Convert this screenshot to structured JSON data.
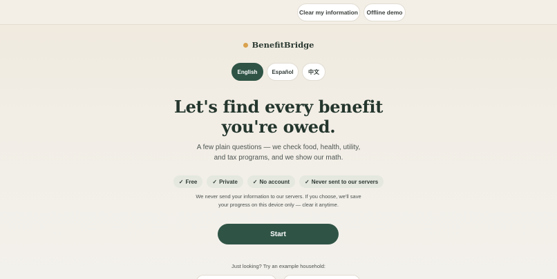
{
  "topbar": {
    "clear_label": "Clear my information",
    "offline_label": "Offline demo"
  },
  "brand": {
    "name": "BenefitBridge",
    "dot_color": "#d9a24e"
  },
  "languages": [
    {
      "label": "English",
      "selected": true
    },
    {
      "label": "Español",
      "selected": false
    },
    {
      "label": "中文",
      "selected": false
    }
  ],
  "hero": {
    "headline_line1": "Let's find every benefit",
    "headline_line2": "you're owed.",
    "sub_line1": "A few plain questions — we check food, health, utility,",
    "sub_line2": "and tax programs, and we show our math."
  },
  "chips": [
    {
      "check": "✓",
      "label": "Free"
    },
    {
      "check": "✓",
      "label": "Private"
    },
    {
      "check": "✓",
      "label": "No account"
    },
    {
      "check": "✓",
      "label": "Never sent to our servers"
    }
  ],
  "privacy": {
    "line1": "We never send your information to our servers. If you choose, we'll save",
    "line2": "your progress on this device only — clear it anytime."
  },
  "start_label": "Start",
  "example": {
    "label": "Just looking? Try an example household:"
  },
  "colors": {
    "primary": "#2f5446",
    "accent": "#d9a24e"
  }
}
